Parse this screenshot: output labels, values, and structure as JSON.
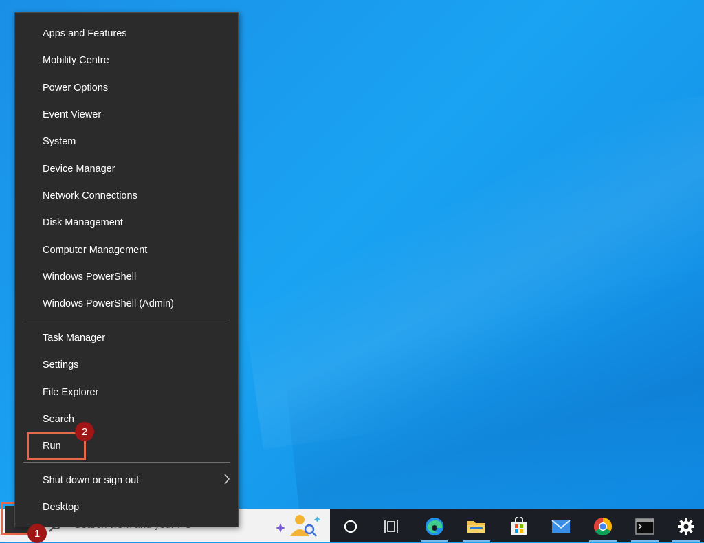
{
  "menu": {
    "group1": [
      "Apps and Features",
      "Mobility Centre",
      "Power Options",
      "Event Viewer",
      "System",
      "Device Manager",
      "Network Connections",
      "Disk Management",
      "Computer Management",
      "Windows PowerShell",
      "Windows PowerShell (Admin)"
    ],
    "group2": [
      "Task Manager",
      "Settings",
      "File Explorer",
      "Search",
      "Run"
    ],
    "group3": [
      "Shut down or sign out",
      "Desktop"
    ]
  },
  "taskbar": {
    "search_placeholder": "Search work and your PC",
    "icons": [
      "cortana-circle-icon",
      "task-view-icon",
      "edge-icon",
      "file-explorer-icon",
      "store-icon",
      "mail-icon",
      "chrome-icon",
      "terminal-icon",
      "settings-gear-icon"
    ]
  },
  "annotations": {
    "badge_start": "1",
    "badge_run": "2",
    "color": "#e8664a",
    "badge_color": "#a01616"
  }
}
